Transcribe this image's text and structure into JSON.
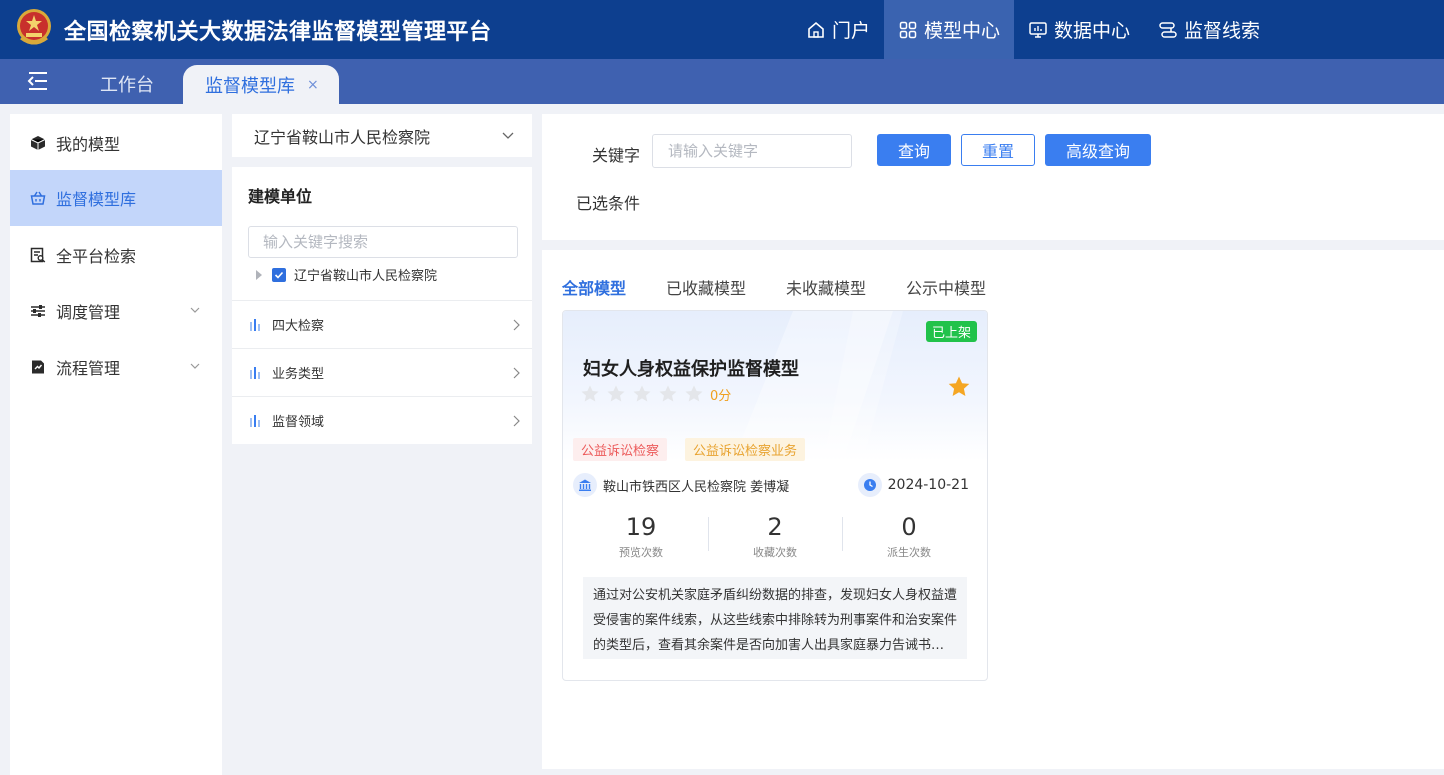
{
  "header": {
    "title": "全国检察机关大数据法律监督模型管理平台",
    "nav": [
      {
        "label": "门户",
        "icon": "home-icon"
      },
      {
        "label": "模型中心",
        "icon": "grid-icon",
        "active": true
      },
      {
        "label": "数据中心",
        "icon": "monitor-icon"
      },
      {
        "label": "监督线索",
        "icon": "link-icon"
      }
    ]
  },
  "tabs": {
    "workbench": "工作台",
    "active": "监督模型库",
    "close": "×"
  },
  "sidebar": {
    "items": [
      {
        "label": "我的模型",
        "icon": "cube-icon"
      },
      {
        "label": "监督模型库",
        "icon": "basket-icon",
        "active": true
      },
      {
        "label": "全平台检索",
        "icon": "search-doc-icon"
      },
      {
        "label": "调度管理",
        "icon": "sliders-icon",
        "expandable": true
      },
      {
        "label": "流程管理",
        "icon": "flow-doc-icon",
        "expandable": true
      }
    ]
  },
  "filters": {
    "org_select": "辽宁省鞍山市人民检察院",
    "unit_title": "建模单位",
    "unit_search_placeholder": "输入关键字搜索",
    "tree_node": "辽宁省鞍山市人民检察院",
    "facets": [
      "四大检察",
      "业务类型",
      "监督领域"
    ]
  },
  "search": {
    "keyword_label": "关键字",
    "keyword_placeholder": "请输入关键字",
    "query_btn": "查询",
    "reset_btn": "重置",
    "advanced_btn": "高级查询",
    "selected_label": "已选条件"
  },
  "results": {
    "tabs": [
      "全部模型",
      "已收藏模型",
      "未收藏模型",
      "公示中模型"
    ],
    "cards": [
      {
        "status": "已上架",
        "title": "妇女人身权益保护监督模型",
        "rating": 0,
        "score_text": "0分",
        "favorited": true,
        "tags": [
          "公益诉讼检察",
          "公益诉讼检察业务"
        ],
        "org": "鞍山市铁西区人民检察院 姜博凝",
        "date": "2024-10-21",
        "stats": [
          {
            "value": "19",
            "label": "预览次数"
          },
          {
            "value": "2",
            "label": "收藏次数"
          },
          {
            "value": "0",
            "label": "派生次数"
          }
        ],
        "description": "通过对公安机关家庭矛盾纠纷数据的排查，发现妇女人身权益遭受侵害的案件线索，从这些线索中排除转为刑事案件和治安案件的类型后，查看其余案件是否向加害人出具家庭暴力告诫书，从而发现公安机关不依法履职的监督线索。"
      }
    ]
  },
  "colors": {
    "header_bg": "#0d3f8f",
    "tabbar_bg": "#3f61b0",
    "accent": "#2f6fde",
    "status_green": "#21c24a"
  }
}
